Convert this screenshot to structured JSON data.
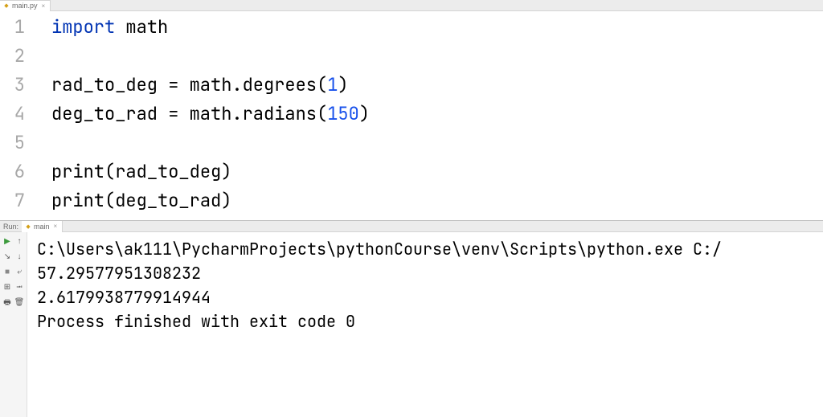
{
  "editor": {
    "tab": {
      "label": "main.py",
      "icon": "python-file-icon"
    },
    "gutter": [
      "1",
      "2",
      "3",
      "4",
      "5",
      "6",
      "7"
    ],
    "code": {
      "l1": {
        "kw": "import",
        "sp": " ",
        "mod": "math"
      },
      "l2": "",
      "l3": {
        "a": "rad_to_deg = math.degrees(",
        "n": "1",
        "b": ")"
      },
      "l4": {
        "a": "deg_to_rad = math.radians(",
        "n": "150",
        "b": ")"
      },
      "l5": "",
      "l6": {
        "fn": "print",
        "open": "(",
        "arg": "rad_to_deg",
        "close": ")"
      },
      "l7": {
        "fn": "print",
        "open": "(",
        "arg": "deg_to_rad",
        "close": ")"
      }
    }
  },
  "run": {
    "label": "Run:",
    "tab": {
      "label": "main",
      "icon": "python-file-icon"
    },
    "toolbar": {
      "rerun": "rerun",
      "stop": "stop",
      "up": "up",
      "down": "down",
      "soft_wrap": "soft-wrap",
      "scroll_to_end": "scroll-to-end",
      "print": "print",
      "clear": "clear"
    },
    "output": {
      "cmd": "C:\\Users\\ak111\\PycharmProjects\\pythonCourse\\venv\\Scripts\\python.exe C:/",
      "line1": "57.29577951308232",
      "line2": "2.6179938779914944",
      "blank": "",
      "exit": "Process finished with exit code 0"
    }
  }
}
